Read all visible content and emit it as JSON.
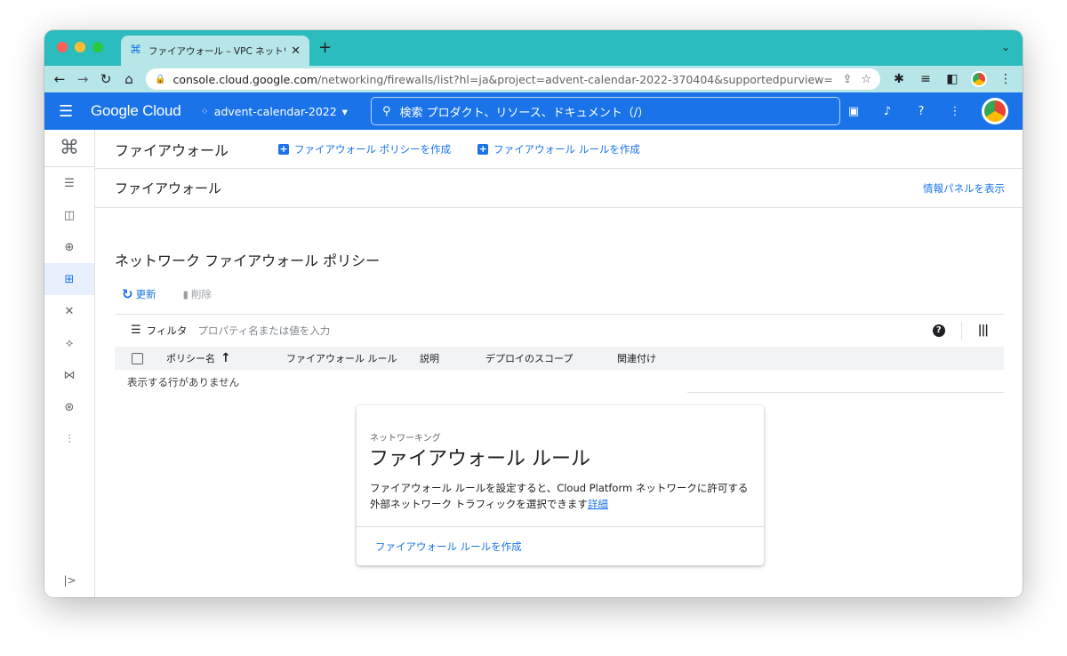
{
  "browser": {
    "tab_title": "ファイアウォール – VPC ネットワ",
    "url_host": "console.cloud.google.com",
    "url_path": "/networking/firewalls/list?hl=ja&project=advent-calendar-2022-370404&supportedpurview=pro..."
  },
  "header": {
    "logo": "Google Cloud",
    "project": "advent-calendar-2022",
    "search_placeholder": "検索  プロダクト、リソース、ドキュメント（/）"
  },
  "toolbar": {
    "title": "ファイアウォール",
    "create_policy": "ファイアウォール ポリシーを作成",
    "create_rule": "ファイアウォール ルールを作成"
  },
  "subbar": {
    "title": "ファイアウォール",
    "info_panel": "情報パネルを表示"
  },
  "section": {
    "title": "ネットワーク ファイアウォール ポリシー",
    "refresh": "更新",
    "delete": "削除"
  },
  "filter": {
    "label": "フィルタ",
    "placeholder": "プロパティ名または値を入力"
  },
  "table": {
    "columns": [
      "ポリシー名",
      "ファイアウォール ルール",
      "説明",
      "デプロイのスコープ",
      "関連付け"
    ],
    "empty": "表示する行がありません"
  },
  "card": {
    "overline": "ネットワーキング",
    "title": "ファイアウォール ルール",
    "desc_line1": "ファイアウォール ルールを設定すると、Cloud Platform ネットワークに許可する",
    "desc_line2": "外部ネットワーク トラフィックを選択できます",
    "desc_link": "詳細",
    "footer": "ファイアウォール ルールを作成"
  },
  "colors": {
    "tabbar": "#2bbcbe",
    "gcp_blue": "#1a73e8"
  }
}
